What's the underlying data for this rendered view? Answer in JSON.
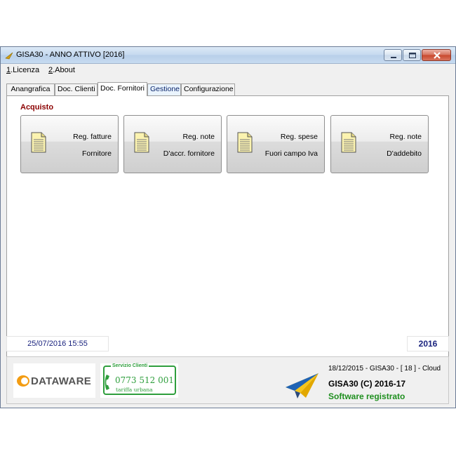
{
  "window": {
    "title": "GISA30 - ANNO ATTIVO  [2016]",
    "controls": {
      "minimize_icon": "minimize-icon",
      "maximize_icon": "maximize-icon",
      "close_icon": "close-icon"
    }
  },
  "menu": [
    {
      "accel": "1",
      "rest": ".Licenza"
    },
    {
      "accel": "2",
      "rest": ".About"
    }
  ],
  "tabs": [
    {
      "label": "Anangrafica",
      "state": "normal"
    },
    {
      "label": "Doc. Clienti",
      "state": "normal"
    },
    {
      "label": "Doc. Fornitori",
      "state": "active"
    },
    {
      "label": "Gestione",
      "state": "hover"
    },
    {
      "label": "Configurazione",
      "state": "normal"
    }
  ],
  "section": {
    "title": "Acquisto"
  },
  "buttons": [
    {
      "line1": "Reg. fatture",
      "line2": "Fornitore",
      "icon": "document-icon"
    },
    {
      "line1": "Reg. note",
      "line2": "D'accr. fornitore",
      "icon": "document-icon"
    },
    {
      "line1": "Reg. spese",
      "line2": "Fuori campo Iva",
      "icon": "document-icon"
    },
    {
      "line1": "Reg. note",
      "line2": "D'addebito",
      "icon": "document-icon"
    }
  ],
  "status": {
    "datetime": "25/07/2016  15:55",
    "year": "2016"
  },
  "footer": {
    "dataware_logo_text": "DATAWARE",
    "servizio": {
      "label": "Servizio Clienti",
      "phone": "0773 512 001",
      "sub": "tariffa urbana"
    },
    "version_line": "18/12/2015 - GISA30 - [ 18 ]  - Cloud",
    "product_line": "GISA30 (C) 2016-17",
    "registered_line": "Software registrato"
  },
  "colors": {
    "section_title": "#8b0000",
    "status_text": "#1a237e",
    "registered": "#1f8f1f",
    "servizio": "#2e9e3c"
  }
}
